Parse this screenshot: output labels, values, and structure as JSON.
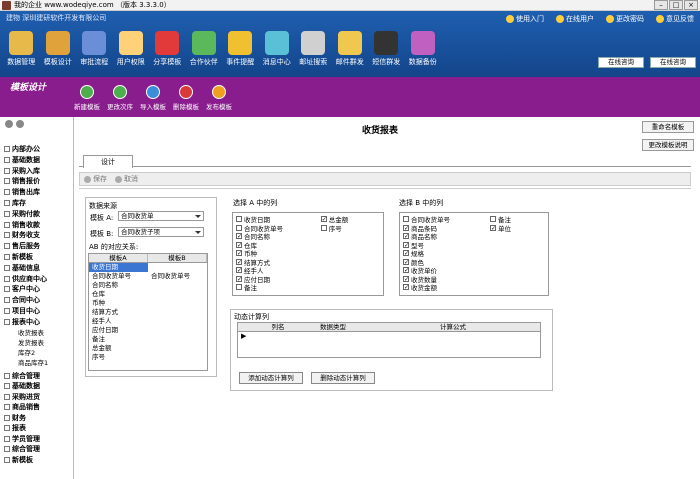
{
  "window": {
    "title": "我的企业 www.wodeqiye.com （版本 3.3.3.0）"
  },
  "header": {
    "subtitle": "建物 深圳建研软件开发有限公司",
    "links": [
      "使用入门",
      "在线用户",
      "更改密码",
      "意见反馈"
    ],
    "toolbar": [
      "数据管理",
      "模板设计",
      "审批流程",
      "用户权限",
      "分享模板",
      "合作伙伴",
      "事件提醒",
      "消息中心",
      "邮址搜索",
      "邮件群发",
      "短信群发",
      "数据备份"
    ],
    "service": [
      "在线咨询",
      "在线咨询"
    ]
  },
  "module": {
    "title": "模板设计",
    "buttons": [
      "新建模板",
      "更改次序",
      "导入模板",
      "删除模板",
      "发布模板"
    ]
  },
  "sidebar": {
    "items": [
      "内部办公",
      "基础数据",
      "采购入库",
      "销售报价",
      "销售出库",
      "库存",
      "采购付款",
      "销售收款",
      "财务收支",
      "售后服务",
      "新模板",
      "基础信息",
      "供应商中心",
      "客户中心",
      "合同中心",
      "项目中心",
      "报表中心"
    ],
    "subitems": [
      "收货报表",
      "发货报表",
      "库存2",
      "商品库存1"
    ],
    "items2": [
      "综合管理",
      "基础数据",
      "采购进货",
      "商品销售",
      "财务",
      "报表",
      "学员管理",
      "综合管理",
      "新模板"
    ]
  },
  "main": {
    "title": "收货报表",
    "right_buttons": [
      "重命名模板",
      "更改模板说明"
    ],
    "tab": "设计",
    "actions": [
      "保存",
      "取消"
    ],
    "source": {
      "label": "数据来源",
      "a_label": "模板 A:",
      "a_value": "合同收货单",
      "b_label": "模板 B:",
      "b_value": "合同收货子项",
      "map_label": "AB 的对应关系:",
      "map_headers": [
        "模板A",
        "模板B"
      ],
      "map_rows": [
        [
          "收货日期",
          ""
        ],
        [
          "合同收货单号",
          "合同收货单号"
        ],
        [
          "合同名称",
          ""
        ],
        [
          "仓库",
          ""
        ],
        [
          "币种",
          ""
        ],
        [
          "结算方式",
          ""
        ],
        [
          "经手人",
          ""
        ],
        [
          "应付日期",
          ""
        ],
        [
          "备注",
          ""
        ],
        [
          "总金额",
          ""
        ],
        [
          "序号",
          ""
        ]
      ]
    },
    "cols_a": {
      "label": "选择 A 中的列",
      "items": [
        [
          "收货日期",
          false
        ],
        [
          "合同收货单号",
          false
        ],
        [
          "合同名称",
          true
        ],
        [
          "仓库",
          true
        ],
        [
          "币种",
          true
        ],
        [
          "结算方式",
          true
        ],
        [
          "经手人",
          true
        ],
        [
          "应付日期",
          true
        ],
        [
          "备注",
          false
        ],
        [
          "总金额",
          true
        ],
        [
          "序号",
          false
        ]
      ]
    },
    "cols_b": {
      "label": "选择 B 中的列",
      "items": [
        [
          "合同收货单号",
          false
        ],
        [
          "商品条码",
          true
        ],
        [
          "商品名称",
          true
        ],
        [
          "型号",
          true
        ],
        [
          "规格",
          true
        ],
        [
          "颜色",
          true
        ],
        [
          "收货单价",
          true
        ],
        [
          "收货数量",
          true
        ],
        [
          "收货金额",
          true
        ],
        [
          "备注",
          false
        ],
        [
          "单位",
          true
        ]
      ]
    },
    "dynamic": {
      "label": "动态计算列",
      "headers": [
        "列名",
        "数据类型",
        "计算公式"
      ],
      "add": "添加动态计算列",
      "delete": "删除动态计算列"
    }
  },
  "colors": {
    "header": "#1f5fb0",
    "module": "#8a1d8d",
    "selection": "#3a76d2"
  }
}
